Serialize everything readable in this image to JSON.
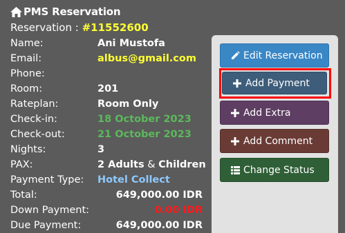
{
  "header": {
    "title": "PMS Reservation",
    "reservation_label": "Reservation : ",
    "reservation_number": "#11552600"
  },
  "details": {
    "name_label": "Name:",
    "name": "Ani Mustofa",
    "email_label": "Email:",
    "email": "albus@gmail.com",
    "phone_label": "Phone:",
    "phone": "",
    "room_label": "Room:",
    "room": "201",
    "rateplan_label": "Rateplan:",
    "rateplan": "Room Only",
    "checkin_label": "Check-in:",
    "checkin": "18 October 2023",
    "checkout_label": "Check-out:",
    "checkout": "21 October 2023",
    "nights_label": "Nights:",
    "nights": "3",
    "pax_label": "PAX:",
    "pax_adults": "2 Adults",
    "pax_sep": " & ",
    "pax_children": "Children",
    "payment_type_label": "Payment Type:",
    "payment_type": "Hotel Collect",
    "total_label": "Total:",
    "total": "649,000.00 IDR",
    "down_payment_label": "Down Payment:",
    "down_payment": "0.00 IDR",
    "due_payment_label": "Due Payment:",
    "due_payment": "649,000.00 IDR"
  },
  "actions": {
    "edit_reservation": "Edit Reservation",
    "add_payment": "Add Payment",
    "add_extra": "Add Extra",
    "add_comment": "Add Comment",
    "change_status": "Change Status"
  },
  "colors": {
    "background": "#5b5b5b",
    "highlight_yellow": "#ffff33",
    "date_green": "#5cb85c",
    "payment_type_blue": "#8ec9ff",
    "down_payment_red": "#ff1a1a",
    "selection_border": "#ff0000"
  },
  "icons": {
    "title": "home-icon",
    "edit": "pencil-icon",
    "add": "plus-icon",
    "status": "list-icon"
  }
}
